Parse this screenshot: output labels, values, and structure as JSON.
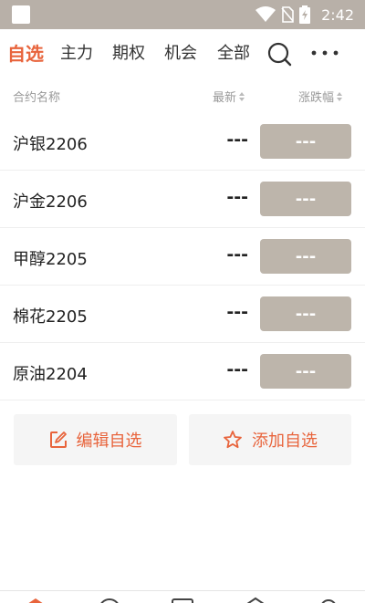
{
  "status_bar": {
    "time": "2:42",
    "icons": [
      "wifi-icon",
      "no-sim-icon",
      "battery-charging-icon"
    ]
  },
  "tabs": [
    {
      "label": "自选",
      "active": true
    },
    {
      "label": "主力",
      "active": false
    },
    {
      "label": "期权",
      "active": false
    },
    {
      "label": "机会",
      "active": false
    },
    {
      "label": "全部",
      "active": false
    }
  ],
  "table": {
    "headers": {
      "name": "合约名称",
      "last": "最新",
      "change": "涨跌幅"
    },
    "rows": [
      {
        "name": "沪银2206",
        "last": "---",
        "change": "---"
      },
      {
        "name": "沪金2206",
        "last": "---",
        "change": "---"
      },
      {
        "name": "甲醇2205",
        "last": "---",
        "change": "---"
      },
      {
        "name": "棉花2205",
        "last": "---",
        "change": "---"
      },
      {
        "name": "原油2204",
        "last": "---",
        "change": "---"
      }
    ]
  },
  "actions": {
    "edit_label": "编辑自选",
    "add_label": "添加自选"
  },
  "colors": {
    "accent": "#e8643c",
    "status_bar": "#b8b0a8",
    "change_bg": "#bdb5ab"
  },
  "bottom_nav": {
    "icons": [
      "home-icon",
      "quote-icon",
      "trade-icon",
      "account-icon",
      "profile-icon"
    ]
  }
}
